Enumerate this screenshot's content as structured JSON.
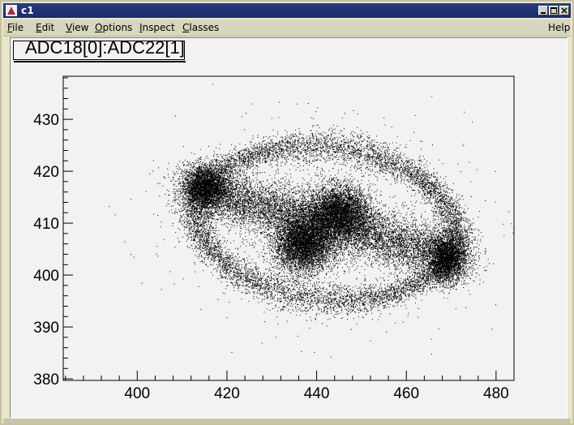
{
  "window": {
    "title": "c1",
    "icon": "root-app-icon",
    "controls": [
      "minimize-icon",
      "maximize-icon",
      "close-icon"
    ]
  },
  "menubar": {
    "items": [
      {
        "label": "File",
        "mnemonic": "F"
      },
      {
        "label": "Edit",
        "mnemonic": "E"
      },
      {
        "label": "View",
        "mnemonic": "V"
      },
      {
        "label": "Options",
        "mnemonic": "O"
      },
      {
        "label": "Inspect",
        "mnemonic": "I"
      },
      {
        "label": "Classes",
        "mnemonic": "C"
      }
    ],
    "help": "Help"
  },
  "canvas": {
    "background": "#f3f1f1",
    "histogram_title": "ADC18[0]:ADC22[1]"
  },
  "chart_data": {
    "type": "scatter",
    "title": "ADC18[0]:ADC22[1]",
    "xlabel": "",
    "ylabel": "",
    "xlim": [
      383.5,
      484
    ],
    "ylim": [
      379.7,
      438.3
    ],
    "x_ticks": [
      400,
      420,
      440,
      460,
      480
    ],
    "y_ticks": [
      380,
      390,
      400,
      410,
      420,
      430
    ],
    "grid": false,
    "marker_color": "#000000",
    "clusters": [
      {
        "region": "outer-ring",
        "center_x": 442,
        "center_y": 410,
        "extent_x": [
          408,
          474
        ],
        "extent_y": [
          389,
          431
        ]
      },
      {
        "region": "dense-left",
        "center_x": 415,
        "center_y": 417
      },
      {
        "region": "dense-center",
        "center_x": 437,
        "center_y": 406
      },
      {
        "region": "dense-center-upper",
        "center_x": 445,
        "center_y": 412
      },
      {
        "region": "dense-right",
        "center_x": 469,
        "center_y": 403
      }
    ]
  }
}
